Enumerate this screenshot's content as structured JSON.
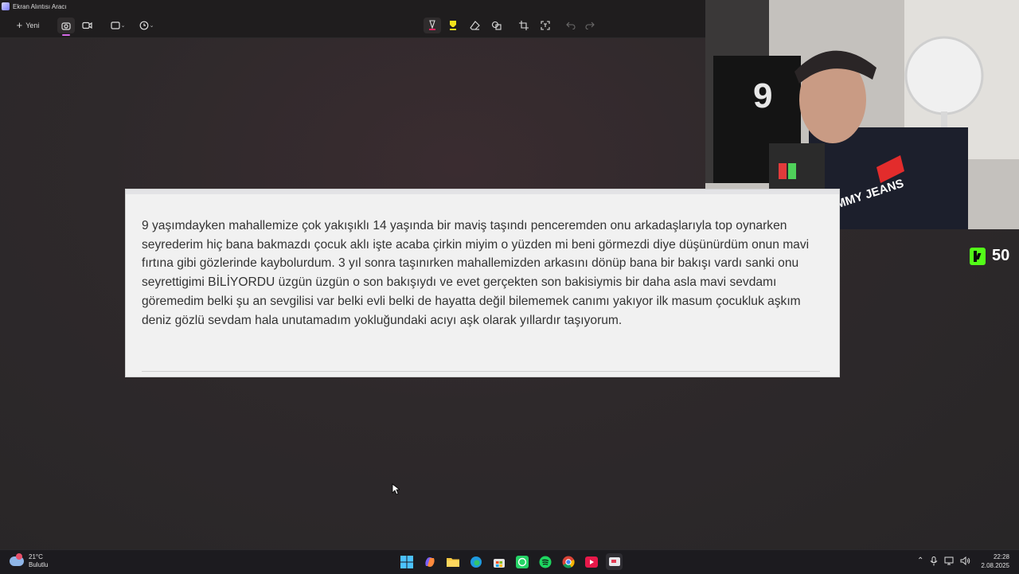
{
  "window": {
    "title": "Ekran Alıntısı Aracı"
  },
  "toolbar": {
    "new_label": "Yeni"
  },
  "card": {
    "text": "9 yaşımdayken mahallemize çok yakışıklı 14 yaşında bir maviş taşındı penceremden onu arkadaşlarıyla top oynarken seyrederim hiç bana bakmazdı çocuk aklı işte acaba çirkin miyim o yüzden mi beni görmezdi diye düşünürdüm onun mavi fırtına gibi gözlerinde kaybolurdum. 3 yıl sonra taşınırken mahallemizden arkasını dönüp bana bir bakışı vardı sanki onu seyrettigimi BİLİYORDU üzgün üzgün o son bakışıydı ve evet gerçekten son bakisiymis bir daha asla mavi sevdamı göremedim belki şu an sevgilisi var belki evli belki de hayatta değil bilememek canımı yakıyor ilk masum çocukluk aşkım deniz gözlü sevdam hala unutamadım yokluğundaki acıyı aşk olarak yıllardır taşıyorum."
  },
  "overlay": {
    "kick_count": "50"
  },
  "taskbar": {
    "weather_temp": "21°C",
    "weather_desc": "Bulutlu",
    "time": "22:28",
    "date": "2.08.2025"
  },
  "colors": {
    "accent": "#d46ae6",
    "kick": "#53fc18",
    "card_bg": "#f1f1f1"
  }
}
